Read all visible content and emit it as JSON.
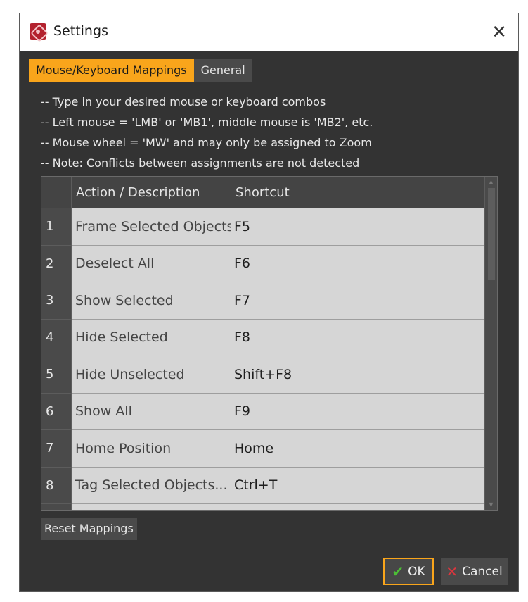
{
  "window": {
    "title": "Settings",
    "icon": "app-logo-icon",
    "close_glyph": "✕"
  },
  "tabs": [
    {
      "label": "Mouse/Keyboard Mappings",
      "active": true
    },
    {
      "label": "General",
      "active": false
    }
  ],
  "notes": [
    "--  Type in your desired mouse or keyboard combos",
    "--  Left mouse = 'LMB' or 'MB1', middle mouse is 'MB2', etc.",
    "--  Mouse wheel = 'MW' and may only be assigned to Zoom",
    "--  Note: Conflicts between assignments are not detected"
  ],
  "table": {
    "headers": {
      "index": "",
      "action": "Action / Description",
      "shortcut": "Shortcut"
    },
    "rows": [
      {
        "index": "1",
        "action": "Frame Selected Objects",
        "shortcut": "F5"
      },
      {
        "index": "2",
        "action": "Deselect All",
        "shortcut": "F6"
      },
      {
        "index": "3",
        "action": "Show Selected",
        "shortcut": "F7"
      },
      {
        "index": "4",
        "action": "Hide Selected",
        "shortcut": "F8"
      },
      {
        "index": "5",
        "action": "Hide Unselected",
        "shortcut": "Shift+F8"
      },
      {
        "index": "6",
        "action": "Show All",
        "shortcut": "F9"
      },
      {
        "index": "7",
        "action": "Home Position",
        "shortcut": "Home"
      },
      {
        "index": "8",
        "action": "Tag Selected Objects...",
        "shortcut": "Ctrl+T"
      },
      {
        "index": "",
        "action": "",
        "shortcut": ""
      }
    ]
  },
  "buttons": {
    "reset_label": "Reset Mappings",
    "ok_label": "OK",
    "cancel_label": "Cancel",
    "ok_glyph": "✔",
    "cancel_glyph": "✕"
  },
  "colors": {
    "accent": "#f9a51b",
    "panel": "#333333",
    "ok_check": "#4cbd36",
    "cancel_x": "#d9363e",
    "app_icon": "#b3222e"
  }
}
